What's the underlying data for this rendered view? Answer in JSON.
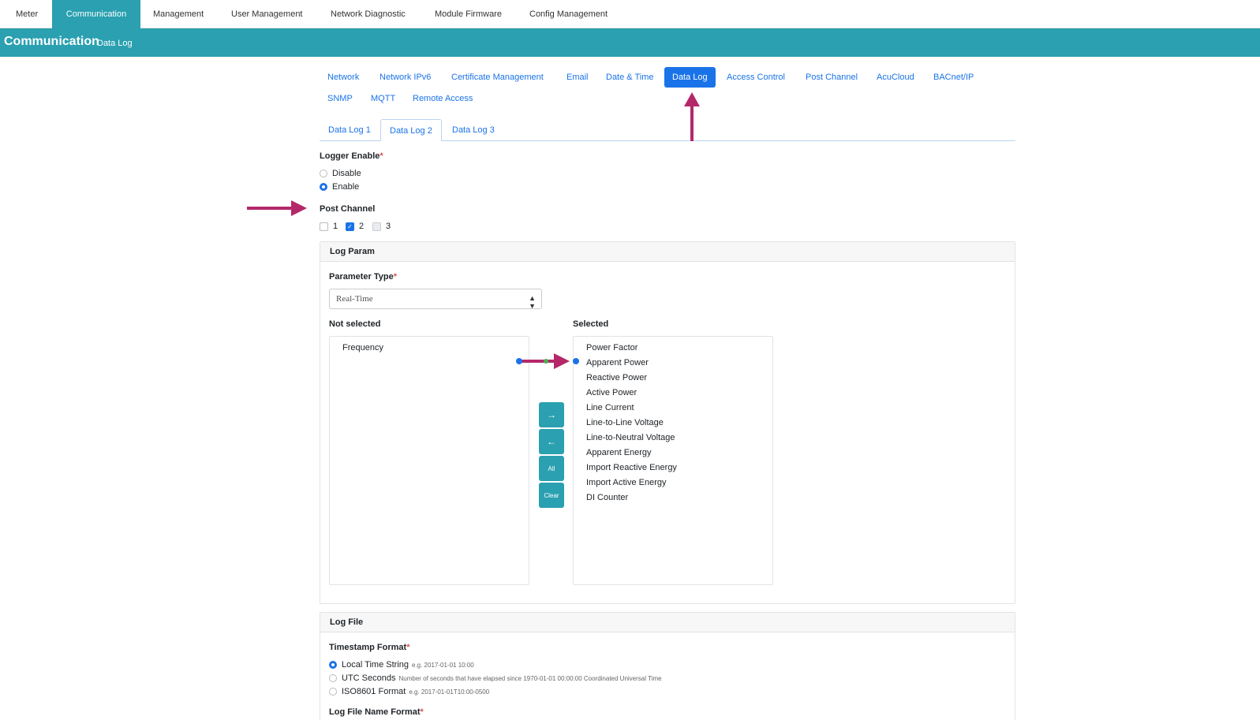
{
  "top_tabs": [
    "Meter",
    "Communication",
    "Management",
    "User Management",
    "Network Diagnostic",
    "Module Firmware",
    "Config Management"
  ],
  "active_top_tab": "Communication",
  "banner": {
    "title": "Communication",
    "subtitle": "Data Log"
  },
  "sub_tabs": {
    "row1": [
      "Network",
      "Network IPv6",
      "Certificate Management",
      "Email",
      "Date & Time",
      "Data Log",
      "Access Control",
      "Post Channel",
      "AcuCloud",
      "BACnet/IP"
    ],
    "row2": [
      "SNMP",
      "MQTT",
      "Remote Access"
    ],
    "active": "Data Log"
  },
  "log_tabs": [
    "Data Log 1",
    "Data Log 2",
    "Data Log 3"
  ],
  "active_log_tab": "Data Log 2",
  "logger_enable": {
    "label": "Logger Enable",
    "options": [
      "Disable",
      "Enable"
    ],
    "selected": "Enable"
  },
  "post_channel": {
    "label": "Post Channel",
    "options": [
      "1",
      "2",
      "3"
    ],
    "checked": [
      "2"
    ]
  },
  "log_param": {
    "title": "Log Param",
    "parameter_type_label": "Parameter Type",
    "parameter_type_value": "Real-Time",
    "not_selected_label": "Not selected",
    "selected_label": "Selected",
    "not_selected": [
      "Frequency"
    ],
    "selected": [
      "Power Factor",
      "Apparent Power",
      "Reactive Power",
      "Active Power",
      "Line Current",
      "Line-to-Line Voltage",
      "Line-to-Neutral Voltage",
      "Apparent Energy",
      "Import Reactive Energy",
      "Import Active Energy",
      "DI Counter"
    ],
    "buttons": {
      "all": "All",
      "clear": "Clear"
    }
  },
  "log_file": {
    "title": "Log File",
    "timestamp_format_label": "Timestamp Format",
    "formats": [
      {
        "label": "Local Time String",
        "hint": "e.g. 2017-01-01 10:00"
      },
      {
        "label": "UTC Seconds",
        "hint": "Number of seconds that have elapsed since 1970-01-01 00:00:00 Coordinated Universal Time"
      },
      {
        "label": "ISO8601 Format",
        "hint": "e.g. 2017-01-01T10:00-0500"
      }
    ],
    "selected_format": "Local Time String",
    "file_name_format_label": "Log File Name Format"
  },
  "colors": {
    "teal": "#2aa0b0",
    "link_blue": "#1a73e8",
    "annotation": "#b4286a"
  }
}
